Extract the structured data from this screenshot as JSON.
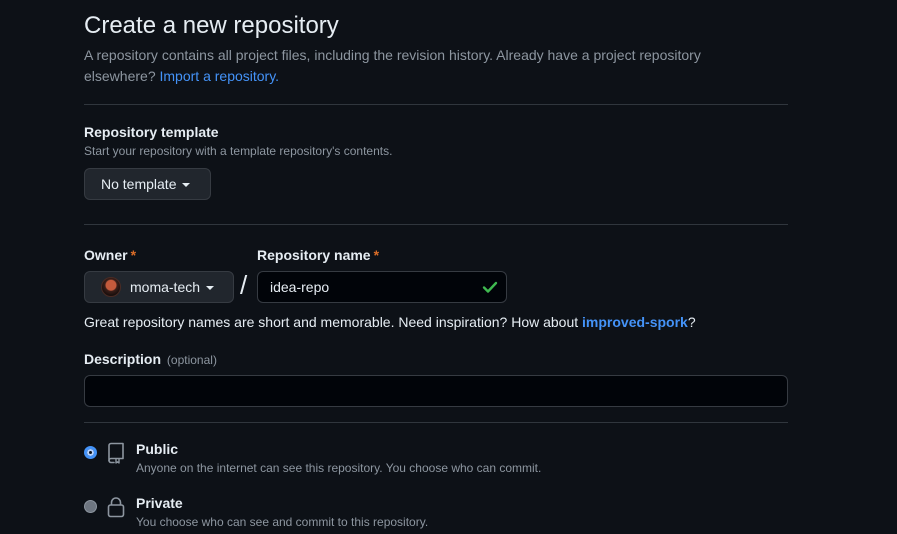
{
  "header": {
    "title": "Create a new repository",
    "subtitle": "A repository contains all project files, including the revision history. Already have a project repository elsewhere?",
    "import_link": "Import a repository."
  },
  "template": {
    "label": "Repository template",
    "note": "Start your repository with a template repository's contents.",
    "button_label": "No template"
  },
  "owner": {
    "label": "Owner",
    "required_mark": "*",
    "value": "moma-tech"
  },
  "separator": "/",
  "repo_name": {
    "label": "Repository name",
    "required_mark": "*",
    "value": "idea-repo",
    "status_icon": "check-icon",
    "status_color": "#3fb950"
  },
  "name_hint": {
    "text": "Great repository names are short and memorable. Need inspiration? How about",
    "suggestion": "improved-spork",
    "suffix": "?"
  },
  "description": {
    "label": "Description",
    "optional": "(optional)",
    "value": ""
  },
  "visibility": {
    "public": {
      "title": "Public",
      "desc": "Anyone on the internet can see this repository. You choose who can commit.",
      "icon": "repo-icon",
      "selected": true
    },
    "private": {
      "title": "Private",
      "desc": "You choose who can see and commit to this repository.",
      "icon": "lock-icon",
      "selected": false
    }
  },
  "colors": {
    "background": "#0d1117",
    "link": "#4493f8",
    "required": "#db6d28",
    "muted": "#8d96a0"
  }
}
